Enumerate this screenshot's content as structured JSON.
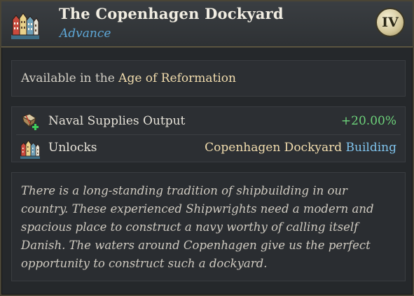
{
  "header": {
    "title": "The Copenhagen Dockyard",
    "subtitle": "Advance",
    "age_numeral": "IV",
    "icon": "harbor-buildings-icon"
  },
  "availability": {
    "prefix": "Available in the",
    "age": "Age of Reformation"
  },
  "effects": [
    {
      "icon": "naval-supplies-plus-icon",
      "label": "Naval Supplies Output",
      "value": "+20.00%"
    },
    {
      "icon": "harbor-buildings-icon",
      "label": "Unlocks",
      "target": "Copenhagen Dockyard",
      "type": "Building"
    }
  ],
  "description": "There is a long-standing tradition of shipbuilding in our country. These experienced Shipwrights need a modern and spacious place to construct a navy worthy of calling itself Danish. The waters around Copenhagen give us the perfect opportunity to construct such a dockyard.",
  "colors": {
    "subtitle": "#5ea8d8",
    "positive": "#6dd27a",
    "highlight": "#f2ddae",
    "link": "#7fc3ec"
  }
}
